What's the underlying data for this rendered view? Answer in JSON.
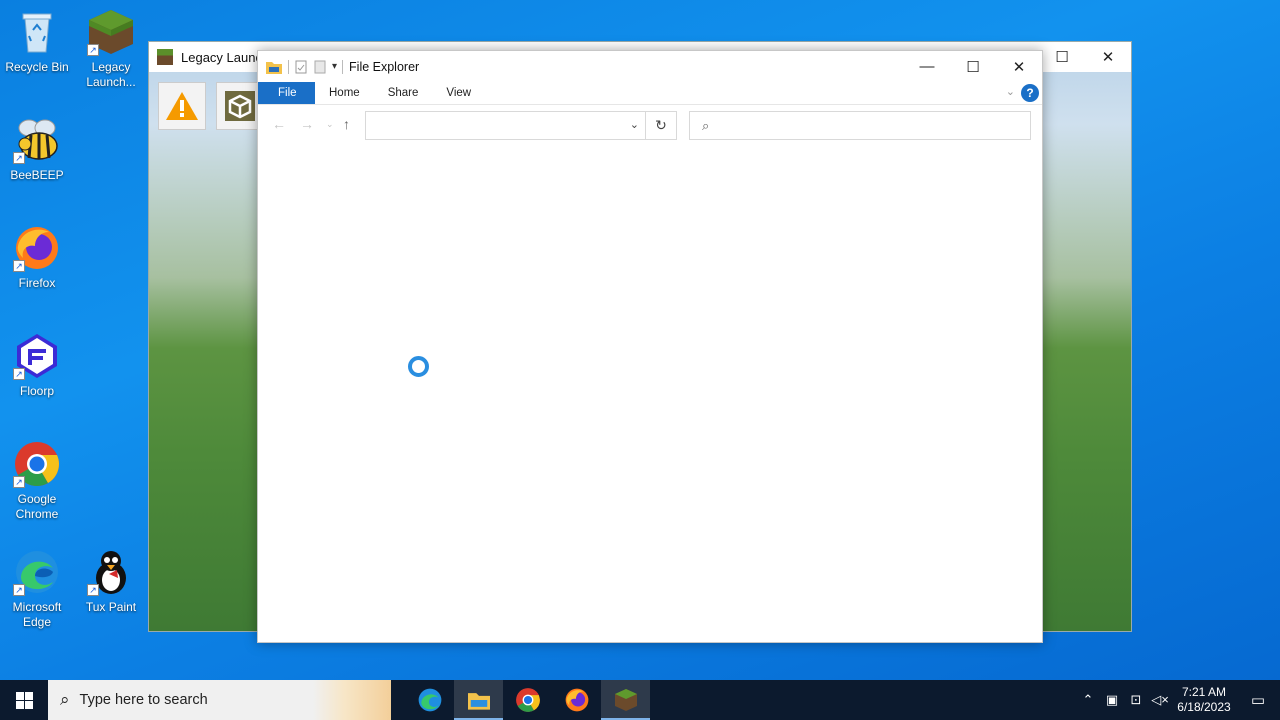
{
  "desktop": {
    "icons": [
      {
        "label": "Recycle Bin"
      },
      {
        "label": "Legacy Launch..."
      },
      {
        "label": "BeeBEEP"
      },
      {
        "label": "Firefox"
      },
      {
        "label": "Floorp"
      },
      {
        "label": "Google Chrome"
      },
      {
        "label": "Microsoft Edge"
      },
      {
        "label": "Tux Paint"
      }
    ]
  },
  "launcher_window": {
    "title": "Legacy Launch"
  },
  "explorer": {
    "title": "File Explorer",
    "tabs": {
      "file": "File",
      "home": "Home",
      "share": "Share",
      "view": "View"
    },
    "help_label": "?",
    "address_value": "",
    "search_placeholder": ""
  },
  "taskbar": {
    "search_placeholder": "Type here to search",
    "clock_time": "7:21 AM",
    "clock_date": "6/18/2023"
  },
  "colors": {
    "accent": "#1a6fc7",
    "taskbar": "#0c1a2e",
    "spinner": "#2a8ee0"
  }
}
